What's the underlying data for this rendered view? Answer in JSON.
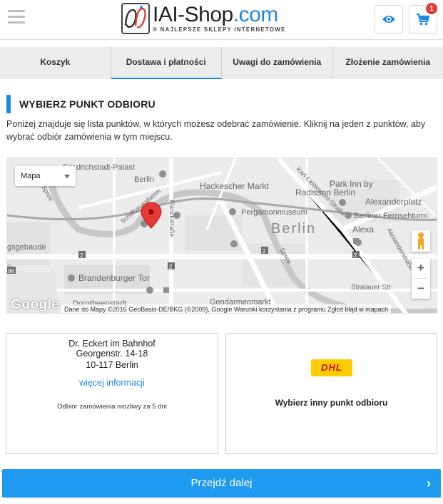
{
  "header": {
    "logo_main": "IAI-Shop",
    "logo_domain": ".com",
    "logo_tagline": "® NAJLEPSZE SKLEPY INTERNETOWE",
    "cart_count": "1",
    "icons": {
      "menu": "hamburger-menu-icon",
      "view": "eye-icon",
      "cart": "shopping-cart-icon"
    },
    "colors": {
      "accent": "#1e88e5",
      "badge": "#e53935"
    }
  },
  "tabs": [
    {
      "label": "Koszyk",
      "active": false
    },
    {
      "label": "Dostawa i płatności",
      "active": true
    },
    {
      "label": "Uwagi do zamówienia",
      "active": false
    },
    {
      "label": "Złożenie zamówienia",
      "active": false
    }
  ],
  "section": {
    "title": "WYBIERZ PUNKT ODBIORU",
    "intro": "Poniżej znajduje się lista punktów, w których możesz odebrać zamówienie. Kliknij na jeden z punktów, aby wybrać odbiór zamówienia w tym miejscu."
  },
  "map": {
    "type_selector": "Mapa",
    "labels": {
      "friedrichstadt": "Friedrichstadt-Palast",
      "berlin_small": "Berlin",
      "hackescher": "Hackescher Markt",
      "parkinn": "Park Inn by",
      "radisson": "Radisson Berlin",
      "alexanderplatz": "Alexanderplatz",
      "fernsehturm": "Berliner Fernsehturm",
      "pergamon": "Pergamonmuseum",
      "berlin_big": "Berlin",
      "alexa": "Alexa",
      "gebaude": "gsgebaude",
      "brandenburger": "Brandenburger Tor",
      "gendarmenmarkt": "Gendarmenmarkt",
      "dorotheenstadt": "Dorotheenstadt",
      "spree1": "Spree",
      "spree2": "Spree",
      "schiffbauerdamm": "Schiffbauerdamm",
      "planckstrasse": "Planckstraße",
      "karl": "Karl-Liebknecht-Straße",
      "alexanderstrasse": "Alexanderstraße",
      "strauer": "Stralauer Str",
      "route2a": "2",
      "route2b": "2",
      "route2c": "2",
      "route2d": "2",
      "route96": "96"
    },
    "google": "Google",
    "attribution": "Dane do Mapy ©2016 GeoBasis-DE/BKG (©2009), Google     Warunki korzystania z programu     Zgłoś błąd w mapach",
    "zoom_in": "+",
    "zoom_out": "−",
    "icons": {
      "marker": "location-pin-icon",
      "pegman": "street-view-pegman-icon",
      "select_caret": "chevron-down-icon"
    }
  },
  "points": {
    "selected": {
      "name": "Dr. Eckert im Bahnhof",
      "street": "Georgenstr. 14-18",
      "city": "10-117 Berlin",
      "more_link": "więcej informacji",
      "note": "Odbiór zamówienia możliwy za 5 dni"
    },
    "other": {
      "carrier_logo": "DHL",
      "label": "Wybierz inny punkt odbioru"
    }
  },
  "continue_button": {
    "label": "Przejdź dalej",
    "icon": "chevron-right-icon"
  }
}
